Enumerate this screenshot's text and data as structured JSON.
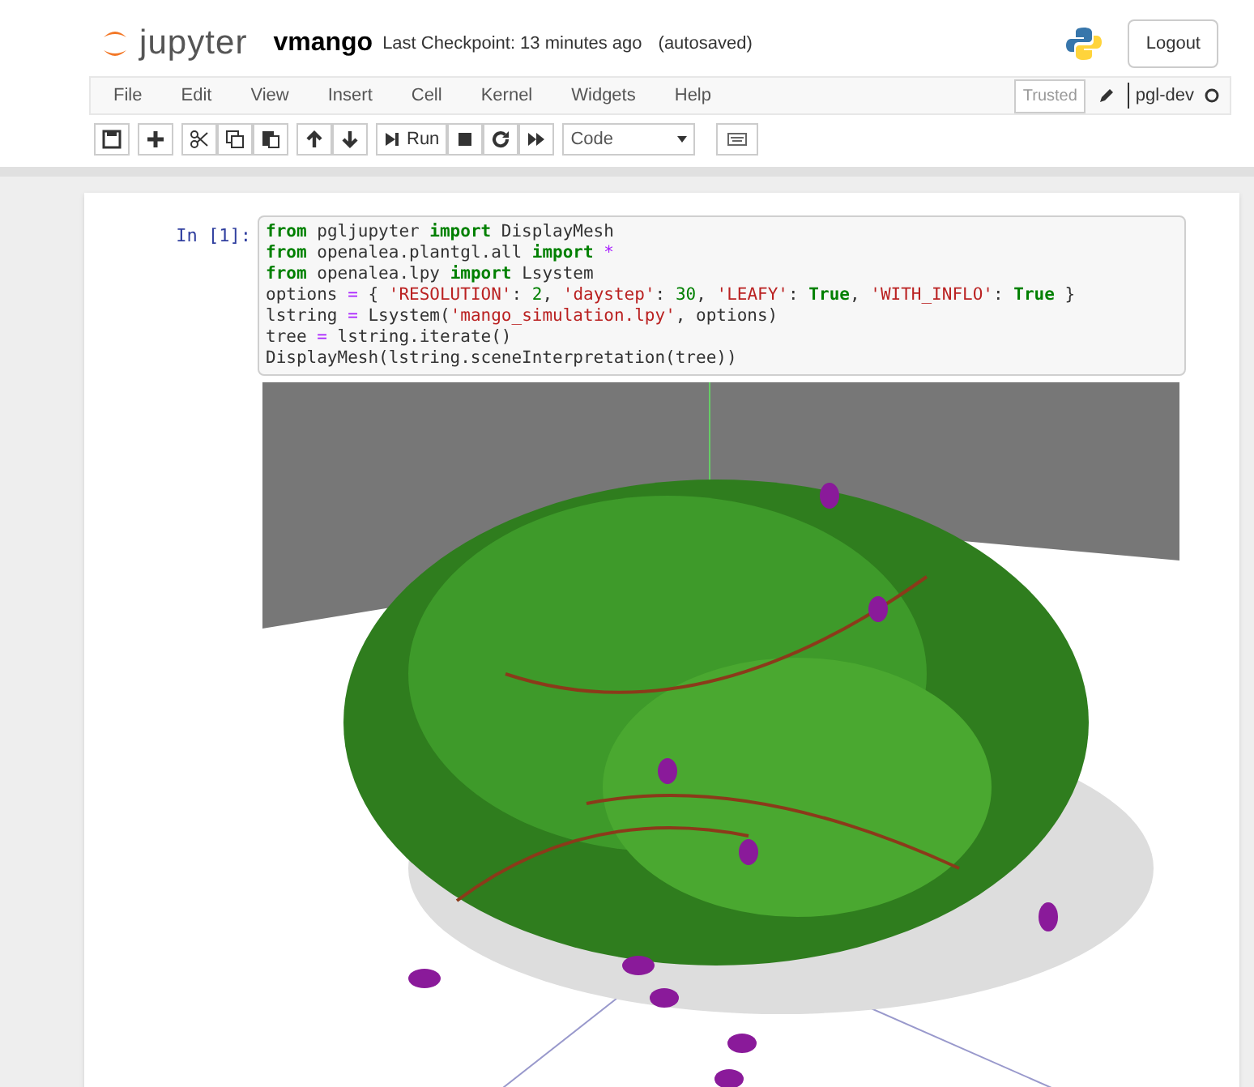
{
  "header": {
    "logo_text": "jupyter",
    "notebook_name": "vmango",
    "checkpoint": "Last Checkpoint: 13 minutes ago",
    "autosave": "(autosaved)",
    "logout": "Logout"
  },
  "menu": {
    "items": [
      "File",
      "Edit",
      "View",
      "Insert",
      "Cell",
      "Kernel",
      "Widgets",
      "Help"
    ],
    "trusted": "Trusted",
    "kernel_name": "pgl-dev"
  },
  "toolbar": {
    "buttons": [
      {
        "kind": "save"
      },
      {
        "kind": "plus"
      },
      {
        "kind": "cut"
      },
      {
        "kind": "copy"
      },
      {
        "kind": "paste"
      },
      {
        "kind": "up"
      },
      {
        "kind": "down"
      },
      {
        "kind": "run",
        "label": "Run"
      },
      {
        "kind": "stop"
      },
      {
        "kind": "restart"
      },
      {
        "kind": "fastforward"
      }
    ],
    "cell_type": "Code"
  },
  "cell": {
    "prompt": "In [1]:",
    "lines": [
      [
        {
          "kind": "keyword",
          "text": "from"
        },
        {
          "kind": "plain",
          "text": " pgljupyter "
        },
        {
          "kind": "keyword",
          "text": "import"
        },
        {
          "kind": "plain",
          "text": " DisplayMesh"
        }
      ],
      [
        {
          "kind": "keyword",
          "text": "from"
        },
        {
          "kind": "plain",
          "text": " openalea.plantgl.all "
        },
        {
          "kind": "keyword",
          "text": "import"
        },
        {
          "kind": "operator",
          "text": " *"
        }
      ],
      [
        {
          "kind": "keyword",
          "text": "from"
        },
        {
          "kind": "plain",
          "text": " openalea.lpy "
        },
        {
          "kind": "keyword",
          "text": "import"
        },
        {
          "kind": "plain",
          "text": " Lsystem"
        }
      ],
      [
        {
          "kind": "plain",
          "text": "options "
        },
        {
          "kind": "operator",
          "text": "="
        },
        {
          "kind": "plain",
          "text": " { "
        },
        {
          "kind": "string",
          "text": "'RESOLUTION'"
        },
        {
          "kind": "plain",
          "text": ": "
        },
        {
          "kind": "number",
          "text": "2"
        },
        {
          "kind": "plain",
          "text": ", "
        },
        {
          "kind": "string",
          "text": "'daystep'"
        },
        {
          "kind": "plain",
          "text": ": "
        },
        {
          "kind": "number",
          "text": "30"
        },
        {
          "kind": "plain",
          "text": ", "
        },
        {
          "kind": "string",
          "text": "'LEAFY'"
        },
        {
          "kind": "plain",
          "text": ": "
        },
        {
          "kind": "keyword",
          "text": "True"
        },
        {
          "kind": "plain",
          "text": ", "
        },
        {
          "kind": "string",
          "text": "'WITH_INFLO'"
        },
        {
          "kind": "plain",
          "text": ": "
        },
        {
          "kind": "keyword",
          "text": "True"
        },
        {
          "kind": "plain",
          "text": " }"
        }
      ],
      [
        {
          "kind": "plain",
          "text": "lstring "
        },
        {
          "kind": "operator",
          "text": "="
        },
        {
          "kind": "plain",
          "text": " Lsystem("
        },
        {
          "kind": "string",
          "text": "'mango_simulation.lpy'"
        },
        {
          "kind": "plain",
          "text": ", options)"
        }
      ],
      [
        {
          "kind": "plain",
          "text": "tree "
        },
        {
          "kind": "operator",
          "text": "="
        },
        {
          "kind": "plain",
          "text": " lstring.iterate()"
        }
      ],
      [
        {
          "kind": "plain",
          "text": "DisplayMesh(lstring.sceneInterpretation(tree))"
        }
      ]
    ]
  }
}
